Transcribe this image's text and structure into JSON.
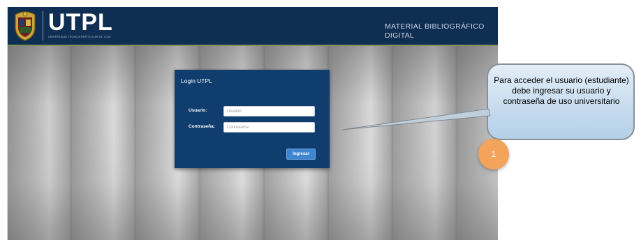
{
  "header": {
    "logo_text": "UTPL",
    "logo_subtitle": "UNIVERSIDAD TÉCNICA PARTICULAR DE LOJA",
    "app_title_line1": "MATERIAL BIBLIOGRÁFICO",
    "app_title_line2": "DIGITAL"
  },
  "login": {
    "title": "Login UTPL",
    "username_label": "Usuario:",
    "username_placeholder": "Usuario",
    "password_label": "Contraseña:",
    "password_placeholder": "Contraseña",
    "submit_label": "Ingresar"
  },
  "callout": {
    "text": "Para acceder el usuario (estudiante) debe ingresar su usuario y contraseña de uso universitario",
    "number": "1"
  },
  "colors": {
    "header_bg": "#0f2f52",
    "panel_bg": "#0e3d6e",
    "button_bg": "#3f86d0",
    "badge": "#f4a35a",
    "callout_fill": "#c6dcf0"
  }
}
